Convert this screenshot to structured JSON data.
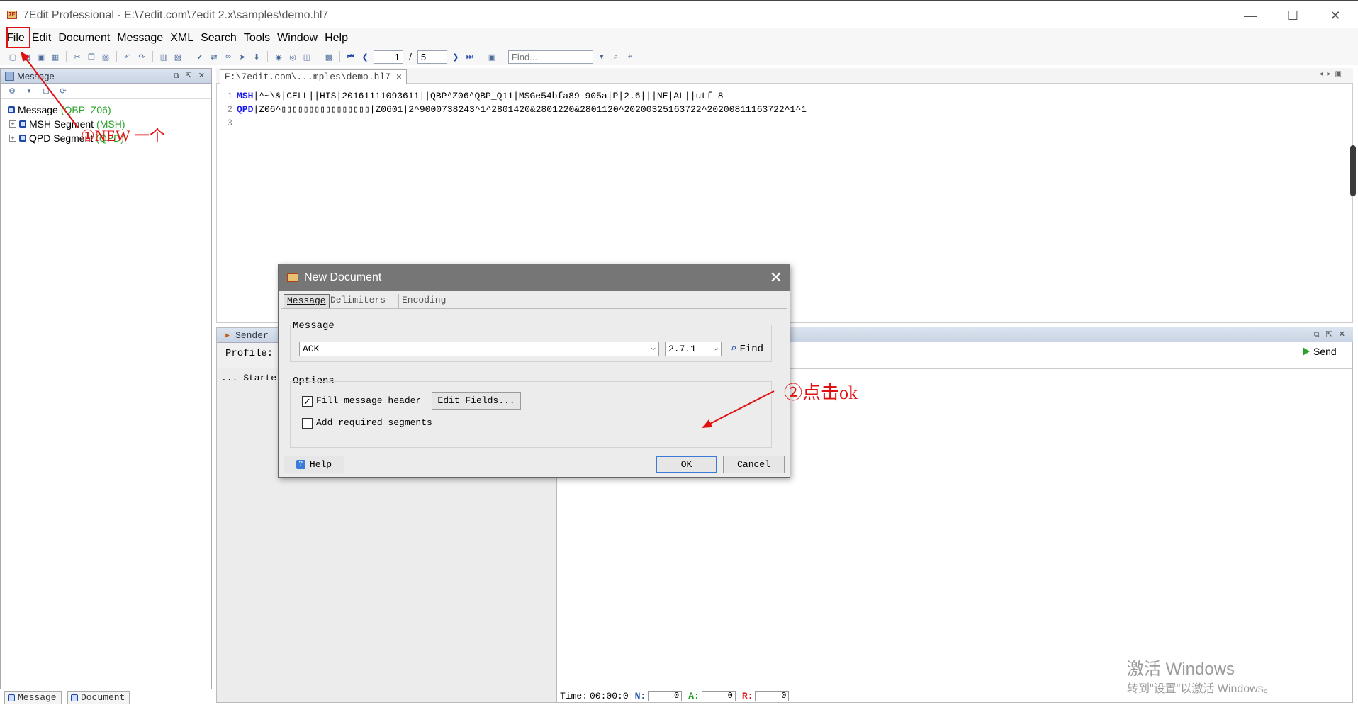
{
  "window": {
    "title": "7Edit Professional - E:\\7edit.com\\7edit 2.x\\samples\\demo.hl7",
    "controls": {
      "minimize": "—",
      "maximize": "☐",
      "close": "✕"
    }
  },
  "menu": [
    "File",
    "Edit",
    "Document",
    "Message",
    "XML",
    "Search",
    "Tools",
    "Window",
    "Help"
  ],
  "toolbar": {
    "page_current": "1",
    "page_sep": "/",
    "page_total": "5",
    "find_placeholder": "Find..."
  },
  "left_panel": {
    "title": "Message",
    "tree": [
      {
        "label": "Message",
        "type": "(QBP_Z06)"
      },
      {
        "label": "MSH Segment",
        "type": "(MSH)"
      },
      {
        "label": "QPD Segment",
        "type": "(QPD)"
      }
    ],
    "bottom_tabs": [
      "Message",
      "Document"
    ]
  },
  "editor": {
    "tab_label": "E:\\7edit.com\\...mples\\demo.hl7",
    "lines": [
      {
        "num": "1",
        "seg": "MSH",
        "rest": "|^~\\&|CELL||HIS|20161111093611||QBP^Z06^QBP_Q11|MSGe54bfa89-905a|P|2.6|||NE|AL||utf-8"
      },
      {
        "num": "2",
        "seg": "QPD",
        "rest": "|Z06^▯▯▯▯▯▯▯▯▯▯▯▯▯▯▯▯|Z0601|2^9000738243^1^2801420&2801220&2801120^20200325163722^20200811163722^1^1"
      },
      {
        "num": "3",
        "seg": "",
        "rest": ""
      }
    ]
  },
  "sender": {
    "title": "Sender",
    "profile_label": "Profile:",
    "log": "... Starte"
  },
  "right_panel": {
    "send_label": "Send",
    "status": {
      "time_label": "Time:",
      "time_value": "00:00:0",
      "n_label": "N:",
      "n_value": "0",
      "a_label": "A:",
      "a_value": "0",
      "r_label": "R:",
      "r_value": "0"
    }
  },
  "dialog": {
    "title": "New Document",
    "tabs": [
      "Message",
      "Delimiters",
      "Encoding"
    ],
    "message_group": "Message",
    "message_value": "ACK",
    "version_value": "2.7.1",
    "find_label": "Find",
    "options_group": "Options",
    "fill_header_label": "Fill message header",
    "fill_header_checked": true,
    "edit_fields_label": "Edit Fields...",
    "add_segments_label": "Add required segments",
    "add_segments_checked": false,
    "help_label": "Help",
    "ok_label": "OK",
    "cancel_label": "Cancel"
  },
  "annotations": {
    "step1": "①NEW 一个",
    "step2": "②点击ok"
  },
  "watermark": {
    "line1": "激活 Windows",
    "line2": "转到\"设置\"以激活 Windows。"
  },
  "colors": {
    "accent_red": "#e01010",
    "segment_blue": "#1a1aee",
    "tree_green": "#2aa12a"
  }
}
